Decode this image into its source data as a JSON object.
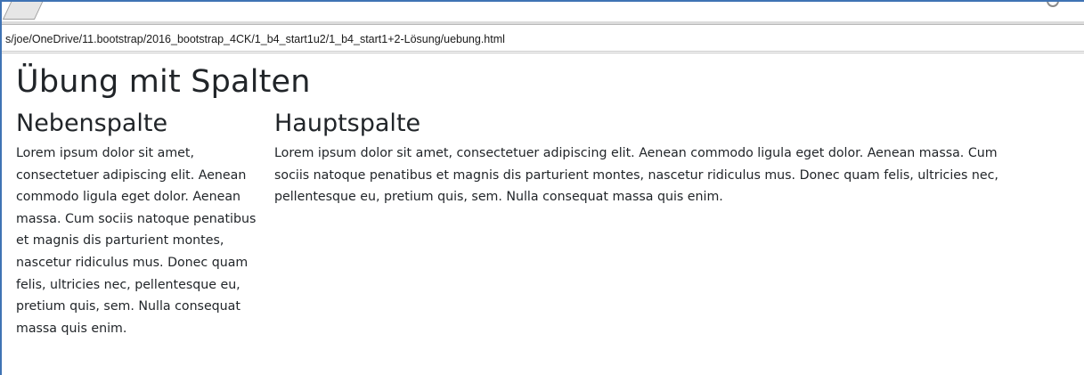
{
  "browser": {
    "url": "s/joe/OneDrive/11.bootstrap/2016_bootstrap_4CK/1_b4_start1u2/1_b4_start1+2-Lösung/uebung.html"
  },
  "page": {
    "title": "Übung mit Spalten",
    "side_column": {
      "heading": "Nebenspalte",
      "text": "Lorem ipsum dolor sit amet, consectetuer adipiscing elit. Aenean commodo ligula eget dolor. Aenean massa. Cum sociis natoque penatibus et magnis dis parturient montes, nascetur ridiculus mus. Donec quam felis, ultricies nec, pellentesque eu, pretium quis, sem. Nulla consequat massa quis enim."
    },
    "main_column": {
      "heading": "Hauptspalte",
      "text": "Lorem ipsum dolor sit amet, consectetuer adipiscing elit. Aenean commodo ligula eget dolor. Aenean massa. Cum sociis natoque penatibus et magnis dis parturient montes, nascetur ridiculus mus. Donec quam felis, ultricies nec, pellentesque eu, pretium quis, sem. Nulla consequat massa quis enim."
    }
  }
}
